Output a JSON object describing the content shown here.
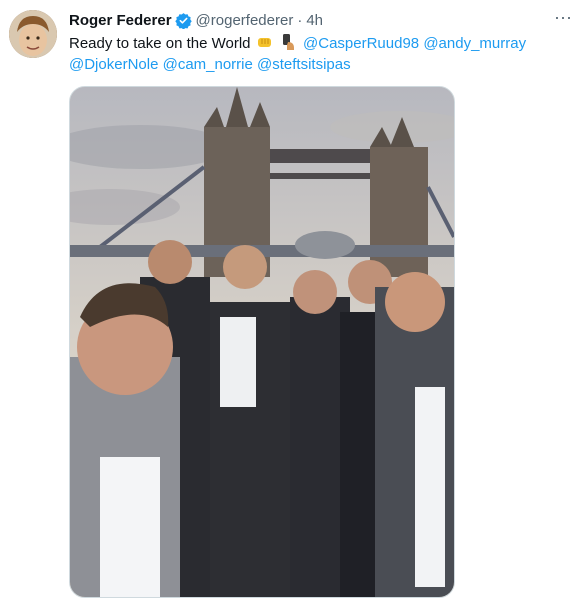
{
  "tweet": {
    "author_name": "Roger Federer",
    "author_handle": "@rogerfederer",
    "separator": "·",
    "time": "4h",
    "more_label": "···",
    "text_prefix": "Ready to take on the World",
    "mentions": [
      "@CasperRuud98",
      "@andy_murray",
      "@DjokerNole",
      "@cam_norrie",
      "@steftsitsipas"
    ]
  },
  "icons": {
    "verified": "verified-badge-icon",
    "more": "more-options-icon",
    "emoji_1": "oncoming-fist-emoji",
    "emoji_2": "selfie-emoji"
  },
  "colors": {
    "accent": "#1d9bf0",
    "text": "#0f1419",
    "secondary": "#536471"
  }
}
